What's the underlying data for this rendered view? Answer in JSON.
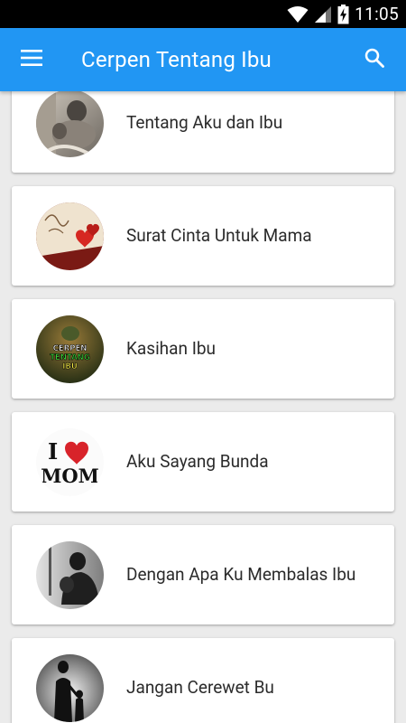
{
  "status_bar": {
    "time": "11:05",
    "icons": [
      "wifi-icon",
      "signal-icon",
      "battery-charging-icon"
    ]
  },
  "app_bar": {
    "title": "Cerpen Tentang Ibu",
    "menu_icon": "menu-icon",
    "search_icon": "search-icon",
    "color": "#2196f3"
  },
  "stories": [
    {
      "title": "Tentang Aku dan Ibu",
      "thumb": "mother-child-photo"
    },
    {
      "title": "Surat Cinta Untuk Mama",
      "thumb": "love-letter-photo"
    },
    {
      "title": "Kasihan Ibu",
      "thumb": "cerpen-tentang-ibu-badge",
      "thumb_text": [
        "CERPEN",
        "TENTANG",
        "IBU"
      ]
    },
    {
      "title": "Aku Sayang Bunda",
      "thumb": "i-love-mom-image",
      "thumb_text": [
        "I",
        "MOM"
      ]
    },
    {
      "title": "Dengan Apa Ku Membalas Ibu",
      "thumb": "hugging-silhouette-photo"
    },
    {
      "title": "Jangan Cerewet Bu",
      "thumb": "mother-child-silhouette-photo"
    }
  ]
}
